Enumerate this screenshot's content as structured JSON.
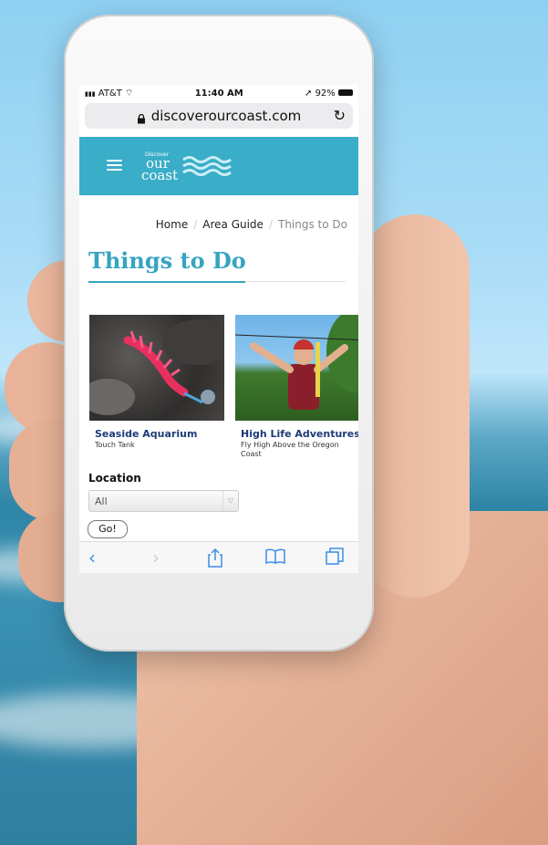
{
  "status_bar": {
    "carrier": "AT&T",
    "time": "11:40 AM",
    "battery": "92%"
  },
  "browser": {
    "url": "discoverourcoast.com"
  },
  "site": {
    "logo_small": "Discover",
    "logo_line1": "our",
    "logo_line2": "coast"
  },
  "breadcrumb": {
    "home": "Home",
    "area_guide": "Area Guide",
    "current": "Things to Do"
  },
  "page": {
    "title": "Things to Do"
  },
  "cards": [
    {
      "name": "Seaside Aquarium",
      "desc": "Touch Tank"
    },
    {
      "name": "High Life Adventures",
      "desc": "Fly High Above the Oregon Coast"
    }
  ],
  "filter": {
    "label": "Location",
    "selected": "All",
    "button": "Go!"
  },
  "icons": {
    "back": "chevron-left-icon",
    "forward": "chevron-right-icon",
    "share": "share-icon",
    "bookmarks": "book-icon",
    "tabs": "tabs-icon"
  }
}
